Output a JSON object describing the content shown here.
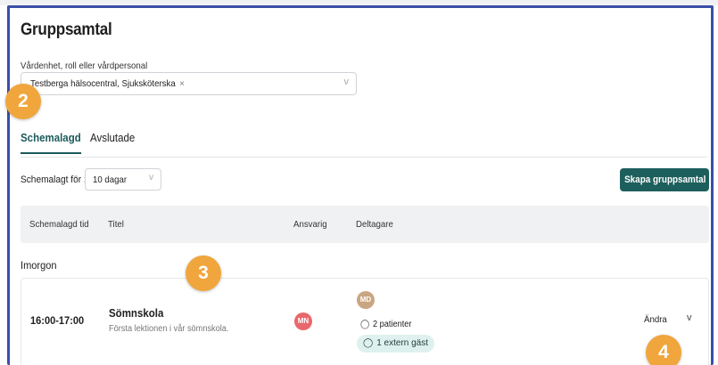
{
  "page": {
    "title": "Gruppsamtal"
  },
  "filter": {
    "label": "Vårdenhet, roll eller vårdpersonal",
    "selected_tag": "Testberga hälsocentral, Sjuksköterska",
    "tag_remove": "×",
    "chevron": "v"
  },
  "tabs": [
    {
      "label": "Schemalagd",
      "active": true
    },
    {
      "label": "Avslutade",
      "active": false
    }
  ],
  "schedule_filter": {
    "label": "Schemalagt för :",
    "value": "10 dagar",
    "chevron": "v"
  },
  "create_button": {
    "label": "Skapa gruppsamtal"
  },
  "table": {
    "headers": [
      "Schemalagd tid",
      "Titel",
      "Ansvarig",
      "Deltagare"
    ],
    "groups": [
      {
        "label": "Imorgon",
        "rows": [
          {
            "time": "16:00-17:00",
            "title": "Sömnskola",
            "description": "Första lektionen i vår sömnskola.",
            "responsible_initials": "MN",
            "participant_initials": "MD",
            "patients": "2 patienter",
            "guests": "1 extern gäst",
            "edit_label": "Ändra",
            "expand": "v"
          }
        ]
      }
    ]
  },
  "step_badges": [
    "2",
    "3",
    "4"
  ],
  "colors": {
    "frame": "#3a4fa8",
    "primary": "#1d5f5c",
    "tab_active": "#1c5b5b",
    "badge": "#f0a63c",
    "avatar_mn": "#e8686d",
    "avatar_md": "#c9a682",
    "guest_chip": "#dff1ee"
  },
  "icons": [
    "user-icon",
    "users-icon",
    "chevron-down-icon",
    "close-icon"
  ]
}
